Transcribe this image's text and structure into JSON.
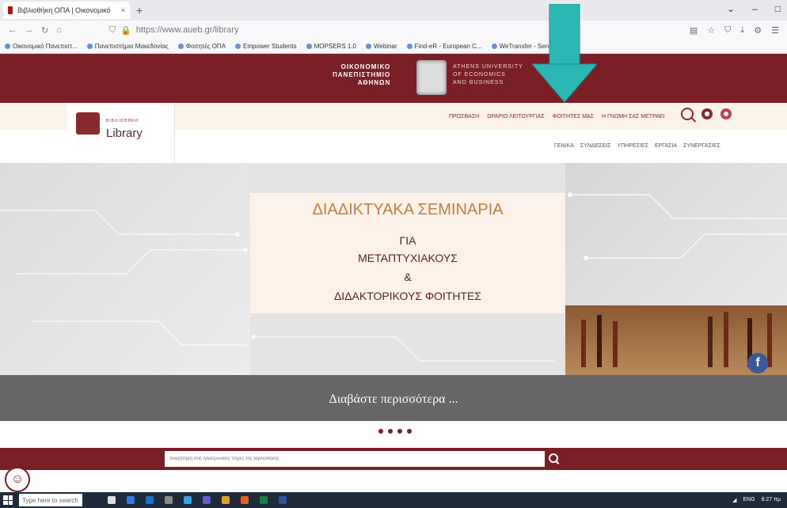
{
  "browser": {
    "tab_title": "Βιβλιοθήκη ΟΠΑ | Οικονομικό",
    "tab_close": "×",
    "new_tab": "+",
    "url_host": "aueb.gr",
    "url_full": "https://www.aueb.gr/library",
    "window_controls": [
      "⌄",
      "–",
      "□"
    ],
    "bookmarks": [
      "Οικονομικό Πανεπιστ...",
      "Πανεπιστήμιο Μακεδονίας",
      "Φοιτητές ΟΠΑ",
      "Empower Students",
      "MOPSERS 1.0",
      "Webinar",
      "Find-eR - European C...",
      "WeTransfer - Send Lar..."
    ]
  },
  "site": {
    "logo_gr": [
      "ΟΙΚΟΝΟΜΙΚΟ",
      "ΠΑΝΕΠΙΣΤΗΜΙΟ",
      "ΑΘΗΝΩΝ"
    ],
    "logo_en": [
      "ATHENS UNIVERSITY",
      "OF ECONOMICS",
      "AND BUSINESS"
    ],
    "library_small": "ΒΙΒΛΙΟΘΗΚΗ",
    "library_name": "Library",
    "top_menu": [
      "ΠΡΟΣΒΑΣΗ",
      "ΩΡΑΡΙΟ ΛΕΙΤΟΥΡΓΙΑΣ",
      "ΦΟΙΤΗΤΕΣ ΜΑΣ",
      "Η ΓΝΩΜΗ ΣΑΣ ΜΕΤΡΑΕΙ"
    ],
    "sub_menu": [
      "ΓΕΝΙΚΑ",
      "ΣΥΝΔΕΣΕΙΣ",
      "ΥΠΗΡΕΣΙΕΣ",
      "ΕΡΓΑΣΙΑ",
      "ΣΥΝΕΡΓΑΣΙΕΣ"
    ]
  },
  "hero": {
    "title": "ΔΙΑΔΙΚΤΥΑΚΑ ΣΕΜΙΝΑΡΙΑ",
    "line1": "ΓΙΑ",
    "line2": "ΜΕΤΑΠΤΥΧΙΑΚΟΥΣ",
    "line3": "&",
    "line4": "ΔΙΔΑΚΤΟΡΙΚΟΥΣ ΦΟΙΤΗΤΕΣ",
    "read_more": "Διαβάστε περισσότερα ...",
    "slides": 4,
    "facebook_glyph": "f"
  },
  "search": {
    "placeholder": "Αναζήτηση στις ηλεκτρονικές πηγές της Βιβλιοθήκης"
  },
  "taskbar": {
    "search_placeholder": "Type here to search",
    "tray_lang": "ENG",
    "tray_time": "8:27 πμ"
  },
  "colors": {
    "brand": "#7a1f26",
    "cream": "#fbf3ea",
    "accent_arrow": "#2bb8b4",
    "hero_title": "#c27d45"
  }
}
